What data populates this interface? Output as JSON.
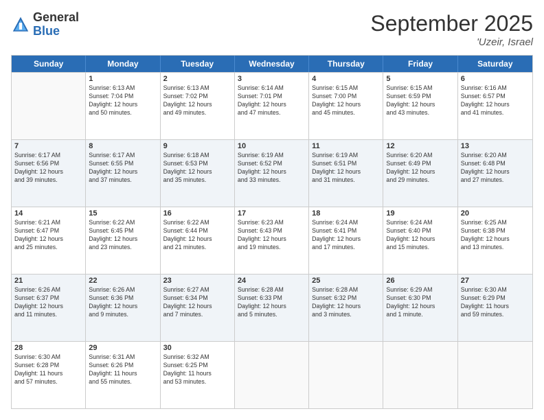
{
  "header": {
    "logo_general": "General",
    "logo_blue": "Blue",
    "month_title": "September 2025",
    "location": "'Uzeir, Israel"
  },
  "days_of_week": [
    "Sunday",
    "Monday",
    "Tuesday",
    "Wednesday",
    "Thursday",
    "Friday",
    "Saturday"
  ],
  "weeks": [
    [
      {
        "day": "",
        "info": ""
      },
      {
        "day": "1",
        "info": "Sunrise: 6:13 AM\nSunset: 7:04 PM\nDaylight: 12 hours\nand 50 minutes."
      },
      {
        "day": "2",
        "info": "Sunrise: 6:13 AM\nSunset: 7:02 PM\nDaylight: 12 hours\nand 49 minutes."
      },
      {
        "day": "3",
        "info": "Sunrise: 6:14 AM\nSunset: 7:01 PM\nDaylight: 12 hours\nand 47 minutes."
      },
      {
        "day": "4",
        "info": "Sunrise: 6:15 AM\nSunset: 7:00 PM\nDaylight: 12 hours\nand 45 minutes."
      },
      {
        "day": "5",
        "info": "Sunrise: 6:15 AM\nSunset: 6:59 PM\nDaylight: 12 hours\nand 43 minutes."
      },
      {
        "day": "6",
        "info": "Sunrise: 6:16 AM\nSunset: 6:57 PM\nDaylight: 12 hours\nand 41 minutes."
      }
    ],
    [
      {
        "day": "7",
        "info": "Sunrise: 6:17 AM\nSunset: 6:56 PM\nDaylight: 12 hours\nand 39 minutes."
      },
      {
        "day": "8",
        "info": "Sunrise: 6:17 AM\nSunset: 6:55 PM\nDaylight: 12 hours\nand 37 minutes."
      },
      {
        "day": "9",
        "info": "Sunrise: 6:18 AM\nSunset: 6:53 PM\nDaylight: 12 hours\nand 35 minutes."
      },
      {
        "day": "10",
        "info": "Sunrise: 6:19 AM\nSunset: 6:52 PM\nDaylight: 12 hours\nand 33 minutes."
      },
      {
        "day": "11",
        "info": "Sunrise: 6:19 AM\nSunset: 6:51 PM\nDaylight: 12 hours\nand 31 minutes."
      },
      {
        "day": "12",
        "info": "Sunrise: 6:20 AM\nSunset: 6:49 PM\nDaylight: 12 hours\nand 29 minutes."
      },
      {
        "day": "13",
        "info": "Sunrise: 6:20 AM\nSunset: 6:48 PM\nDaylight: 12 hours\nand 27 minutes."
      }
    ],
    [
      {
        "day": "14",
        "info": "Sunrise: 6:21 AM\nSunset: 6:47 PM\nDaylight: 12 hours\nand 25 minutes."
      },
      {
        "day": "15",
        "info": "Sunrise: 6:22 AM\nSunset: 6:45 PM\nDaylight: 12 hours\nand 23 minutes."
      },
      {
        "day": "16",
        "info": "Sunrise: 6:22 AM\nSunset: 6:44 PM\nDaylight: 12 hours\nand 21 minutes."
      },
      {
        "day": "17",
        "info": "Sunrise: 6:23 AM\nSunset: 6:43 PM\nDaylight: 12 hours\nand 19 minutes."
      },
      {
        "day": "18",
        "info": "Sunrise: 6:24 AM\nSunset: 6:41 PM\nDaylight: 12 hours\nand 17 minutes."
      },
      {
        "day": "19",
        "info": "Sunrise: 6:24 AM\nSunset: 6:40 PM\nDaylight: 12 hours\nand 15 minutes."
      },
      {
        "day": "20",
        "info": "Sunrise: 6:25 AM\nSunset: 6:38 PM\nDaylight: 12 hours\nand 13 minutes."
      }
    ],
    [
      {
        "day": "21",
        "info": "Sunrise: 6:26 AM\nSunset: 6:37 PM\nDaylight: 12 hours\nand 11 minutes."
      },
      {
        "day": "22",
        "info": "Sunrise: 6:26 AM\nSunset: 6:36 PM\nDaylight: 12 hours\nand 9 minutes."
      },
      {
        "day": "23",
        "info": "Sunrise: 6:27 AM\nSunset: 6:34 PM\nDaylight: 12 hours\nand 7 minutes."
      },
      {
        "day": "24",
        "info": "Sunrise: 6:28 AM\nSunset: 6:33 PM\nDaylight: 12 hours\nand 5 minutes."
      },
      {
        "day": "25",
        "info": "Sunrise: 6:28 AM\nSunset: 6:32 PM\nDaylight: 12 hours\nand 3 minutes."
      },
      {
        "day": "26",
        "info": "Sunrise: 6:29 AM\nSunset: 6:30 PM\nDaylight: 12 hours\nand 1 minute."
      },
      {
        "day": "27",
        "info": "Sunrise: 6:30 AM\nSunset: 6:29 PM\nDaylight: 11 hours\nand 59 minutes."
      }
    ],
    [
      {
        "day": "28",
        "info": "Sunrise: 6:30 AM\nSunset: 6:28 PM\nDaylight: 11 hours\nand 57 minutes."
      },
      {
        "day": "29",
        "info": "Sunrise: 6:31 AM\nSunset: 6:26 PM\nDaylight: 11 hours\nand 55 minutes."
      },
      {
        "day": "30",
        "info": "Sunrise: 6:32 AM\nSunset: 6:25 PM\nDaylight: 11 hours\nand 53 minutes."
      },
      {
        "day": "",
        "info": ""
      },
      {
        "day": "",
        "info": ""
      },
      {
        "day": "",
        "info": ""
      },
      {
        "day": "",
        "info": ""
      }
    ]
  ]
}
